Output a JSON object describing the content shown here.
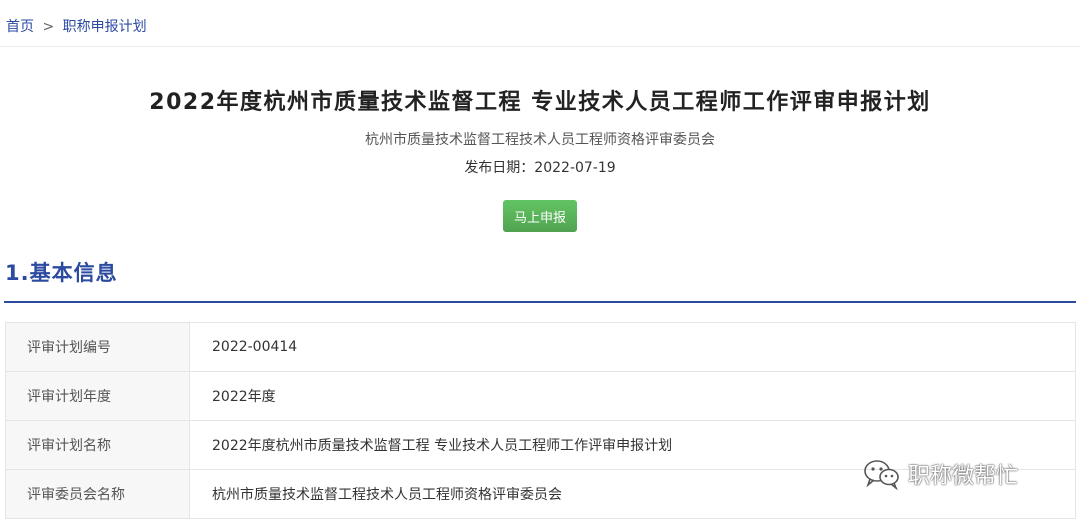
{
  "breadcrumb": {
    "home": "首页",
    "separator": ">",
    "current": "职称申报计划"
  },
  "header": {
    "title": "2022年度杭州市质量技术监督工程 专业技术人员工程师工作评审申报计划",
    "committee": "杭州市质量技术监督工程技术人员工程师资格评审委员会",
    "publish_date": "发布日期：2022-07-19"
  },
  "actions": {
    "apply_label": "马上申报"
  },
  "section": {
    "title": "1.基本信息"
  },
  "info_rows": [
    {
      "label": "评审计划编号",
      "value": "2022-00414"
    },
    {
      "label": "评审计划年度",
      "value": "2022年度"
    },
    {
      "label": "评审计划名称",
      "value": "2022年度杭州市质量技术监督工程 专业技术人员工程师工作评审申报计划"
    },
    {
      "label": "评审委员会名称",
      "value": "杭州市质量技术监督工程技术人员工程师资格评审委员会"
    }
  ],
  "watermark": {
    "icon": "wechat-icon",
    "text": "职称微帮忙"
  },
  "colors": {
    "link": "#2b4aa0",
    "accent": "#2b4aa0",
    "button": "#5cb85c"
  }
}
